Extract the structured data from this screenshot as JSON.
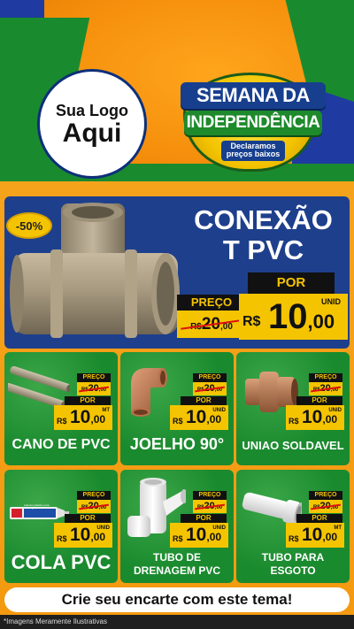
{
  "header": {
    "logo_top": "Sua Logo",
    "logo_main": "Aqui",
    "badge_line1": "SEMANA DA",
    "badge_line2": "INDEPENDÊNCIA",
    "badge_sub": "Declaramos preços baixos"
  },
  "hero": {
    "discount": "-50%",
    "title_line1": "CONEXÃO",
    "title_line2": "T PVC",
    "preco_label": "PREÇO",
    "old_currency": "R$",
    "old_int": "20",
    "old_dec": ",00",
    "por_label": "POR",
    "new_currency": "R$",
    "new_int": "10",
    "new_dec": ",00",
    "unit": "UNID"
  },
  "products": [
    {
      "name": "CANO DE PVC",
      "preco_label": "PREÇO",
      "old_currency": "R$",
      "old_int": "20",
      "old_dec": ",00",
      "por_label": "POR",
      "new_currency": "R$",
      "new_int": "10",
      "new_dec": ",00",
      "unit": "MT"
    },
    {
      "name": "JOELHO 90°",
      "preco_label": "PREÇO",
      "old_currency": "R$",
      "old_int": "20",
      "old_dec": ",00",
      "por_label": "POR",
      "new_currency": "R$",
      "new_int": "10",
      "new_dec": ",00",
      "unit": "UNID"
    },
    {
      "name": "UNIAO SOLDAVEL",
      "preco_label": "PREÇO",
      "old_currency": "R$",
      "old_int": "20",
      "old_dec": ",00",
      "por_label": "POR",
      "new_currency": "R$",
      "new_int": "10",
      "new_dec": ",00",
      "unit": "UNID"
    },
    {
      "name": "COLA PVC",
      "preco_label": "PREÇO",
      "old_currency": "R$",
      "old_int": "20",
      "old_dec": ",00",
      "por_label": "POR",
      "new_currency": "R$",
      "new_int": "10",
      "new_dec": ",00",
      "unit": "UNID",
      "tube_label": "Adesivo plástico para PVC rígido"
    },
    {
      "name_line1": "TUBO DE",
      "name_line2": "DRENAGEM PVC",
      "preco_label": "PREÇO",
      "old_currency": "R$",
      "old_int": "20",
      "old_dec": ",00",
      "por_label": "POR",
      "new_currency": "R$",
      "new_int": "10",
      "new_dec": ",00",
      "unit": "UNID"
    },
    {
      "name_line1": "TUBO PARA",
      "name_line2": "ESGOTO",
      "preco_label": "PREÇO",
      "old_currency": "R$",
      "old_int": "20",
      "old_dec": ",00",
      "por_label": "POR",
      "new_currency": "R$",
      "new_int": "10",
      "new_dec": ",00",
      "unit": "MT"
    }
  ],
  "cta": "Crie seu encarte com este tema!",
  "footer": "*Imagens Meramente Ilustrativas",
  "colors": {
    "orange": "#f39a10",
    "green": "#1a8a2e",
    "blue": "#1e3f8c",
    "yellow": "#f5c400",
    "black": "#111111"
  }
}
